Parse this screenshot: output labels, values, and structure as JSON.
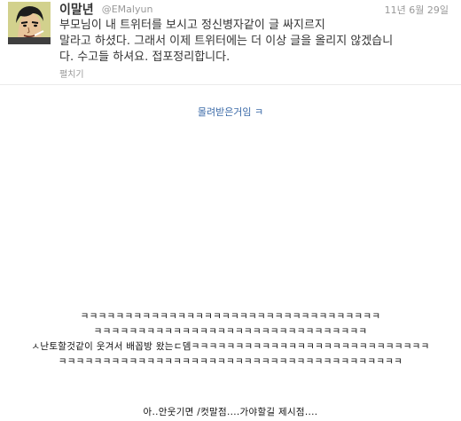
{
  "tweet": {
    "display_name": "이말년",
    "username": "@EMalyun",
    "timestamp": "11년 6월 29일",
    "text_lines": [
      "부모님이 내 트위터를 보시고 정신병자같이 글 싸지르지",
      "말라고 하셨다. 그래서 이제 트위터에는 더 이상 글을 올리지 않겠습니",
      "다. 수고들 하셔요. 접포정리합니다."
    ],
    "expand_label": "펼치기",
    "avatar_icon": "user-avatar-icon"
  },
  "caption": "몰려받은거임 ㅋ",
  "comic_lines": [
    "ㅋㅋㅋㅋㅋㅋㅋㅋㅋㅋㅋㅋㅋㅋㅋㅋㅋㅋㅋㅋㅋㅋㅋㅋㅋㅋㅋㅋㅋㅋㅋㅋㅋㅋ",
    "ㅋㅋㅋㅋㅋㅋㅋㅋㅋㅋㅋㅋㅋㅋㅋㅋㅋㅋㅋㅋㅋㅋㅋㅋㅋㅋㅋㅋㅋㅋㅋ",
    "ㅅ난토할것같이 웃겨서 배꼽방 왔는ㄷ뎀ㅋㅋㅋㅋㅋㅋㅋㅋㅋㅋㅋㅋㅋㅋㅋㅋㅋㅋㅋㅋㅋㅋㅋㅋㅋㅋㅋ",
    "ㅋㅋㅋㅋㅋㅋㅋㅋㅋㅋㅋㅋㅋㅋㅋㅋㅋㅋㅋㅋㅋㅋㅋㅋㅋㅋㅋㅋㅋㅋㅋㅋㅋㅋㅋㅋㅋㅋㅋ",
    "아..안웃기면 /컷말점....가야할길 제시점...."
  ]
}
